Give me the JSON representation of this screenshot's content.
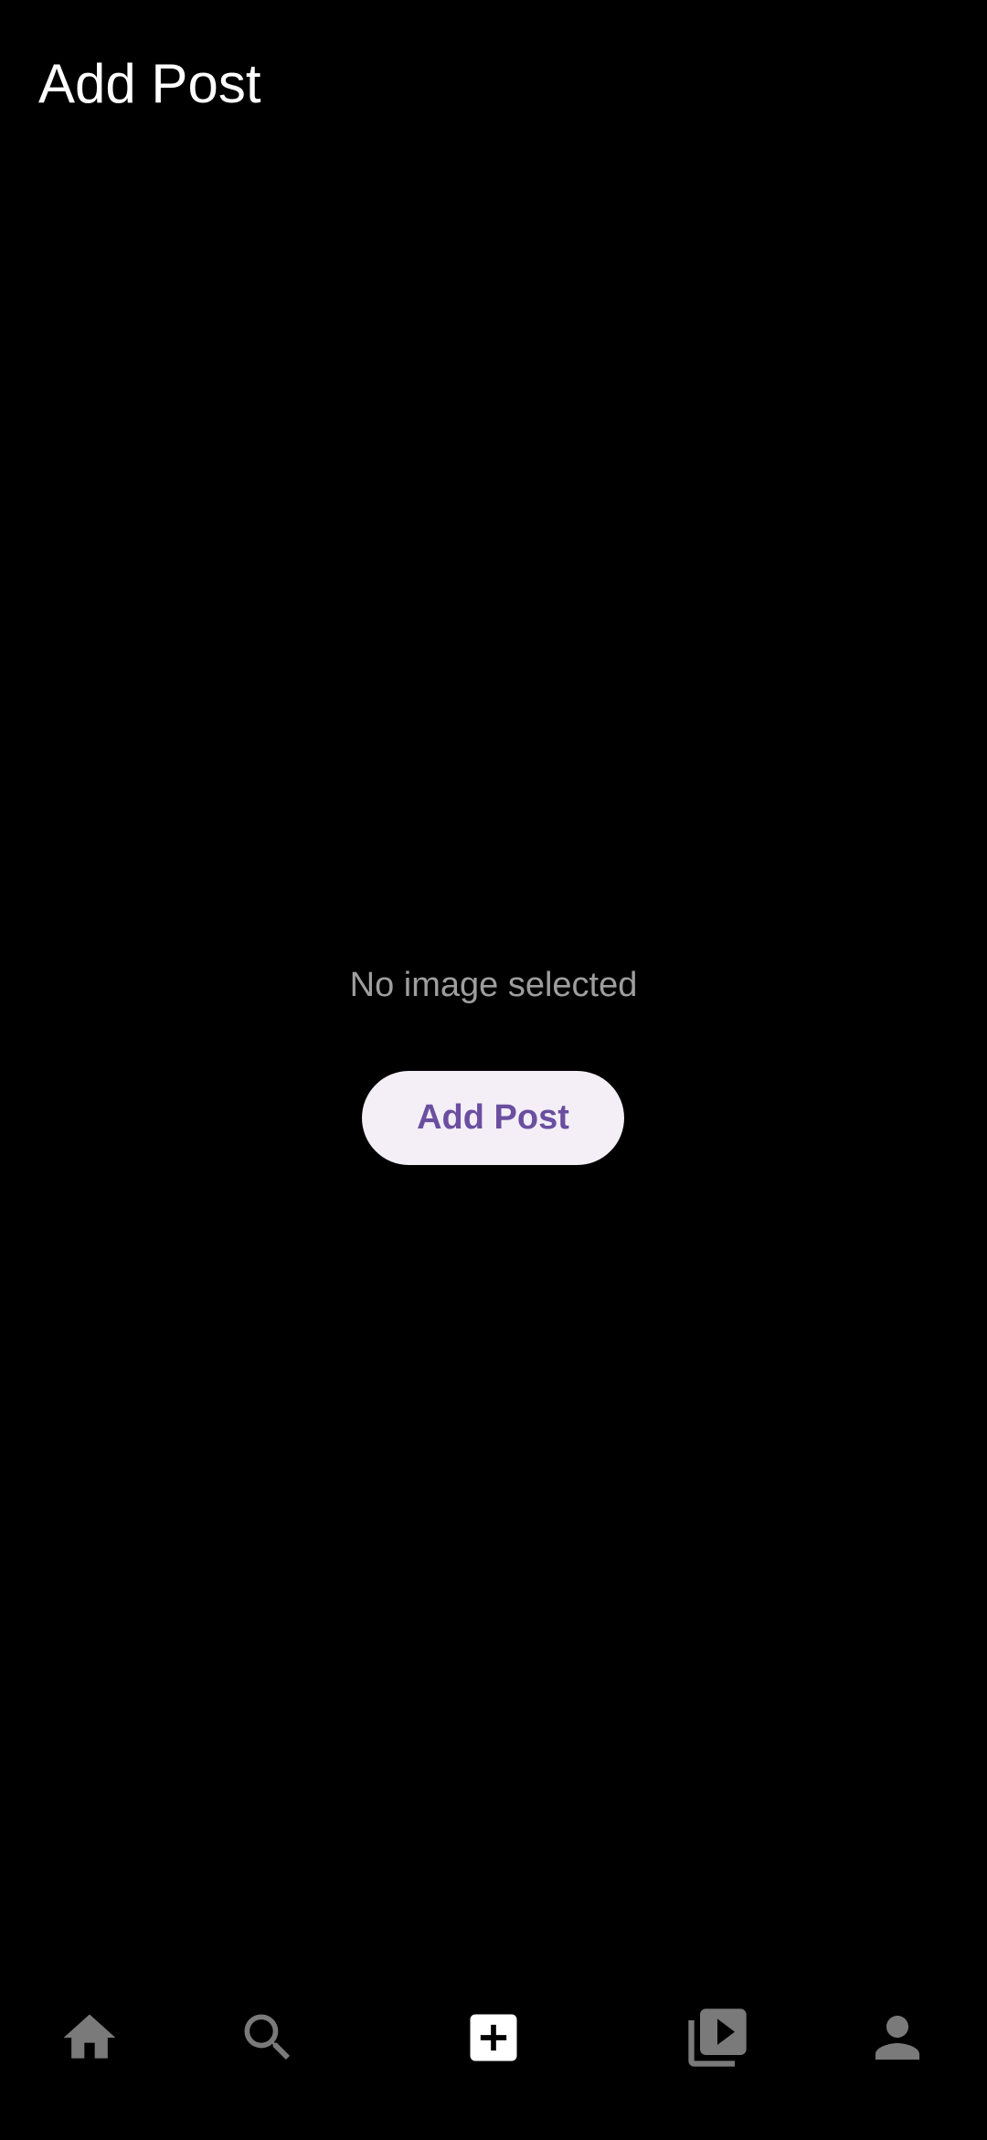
{
  "header": {
    "title": "Add Post"
  },
  "main": {
    "empty_message": "No image selected",
    "add_button_label": "Add Post"
  },
  "bottom_nav": {
    "items": [
      {
        "icon": "home-icon",
        "selected": false
      },
      {
        "icon": "search-icon",
        "selected": false
      },
      {
        "icon": "add-box-icon",
        "selected": true
      },
      {
        "icon": "video-library-icon",
        "selected": false
      },
      {
        "icon": "person-icon",
        "selected": false
      }
    ]
  },
  "colors": {
    "background": "#000000",
    "title_text": "#ffffff",
    "secondary_text": "#9e9e9e",
    "button_background": "#f4eef7",
    "button_text": "#6a4fa0",
    "nav_inactive": "#7a7a7a",
    "nav_active": "#ffffff"
  }
}
